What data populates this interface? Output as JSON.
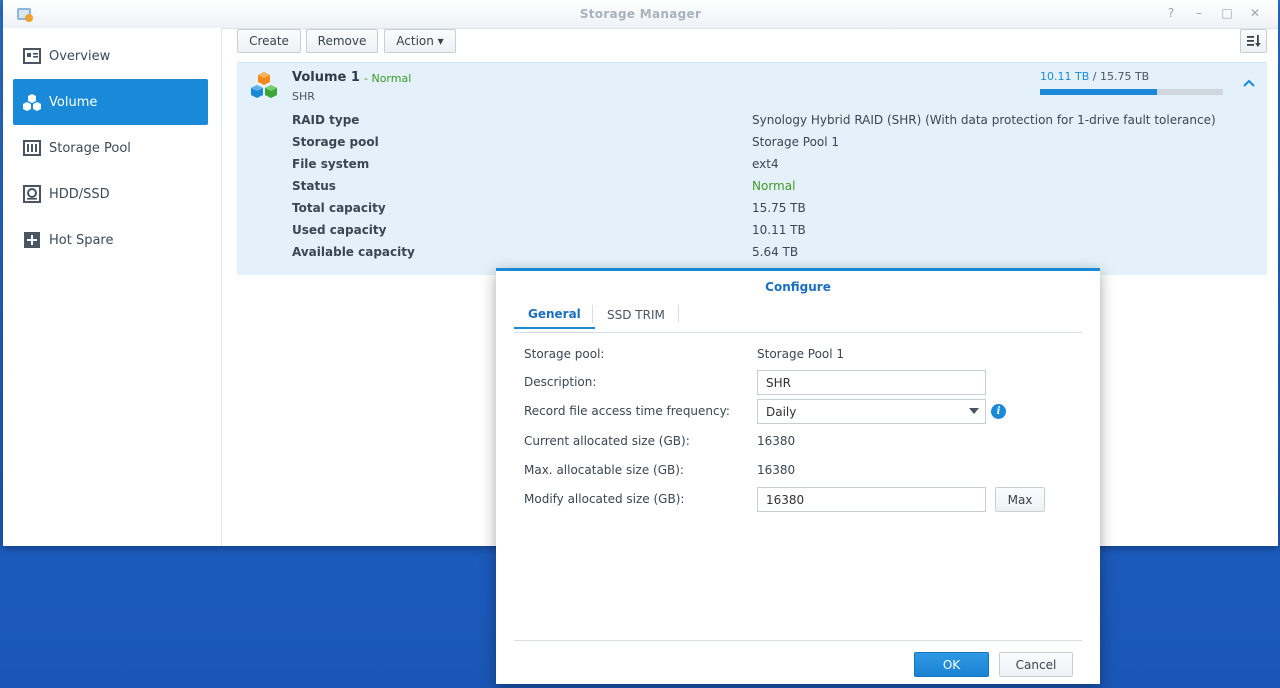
{
  "window": {
    "title": "Storage Manager",
    "help": "?",
    "minimize": "–",
    "maximize": "□",
    "close": "✕"
  },
  "sidebar": {
    "items": [
      {
        "label": "Overview",
        "icon": "overview-icon",
        "active": false
      },
      {
        "label": "Volume",
        "icon": "volume-icon",
        "active": true
      },
      {
        "label": "Storage Pool",
        "icon": "storage-pool-icon",
        "active": false
      },
      {
        "label": "HDD/SSD",
        "icon": "hdd-icon",
        "active": false
      },
      {
        "label": "Hot Spare",
        "icon": "hot-spare-icon",
        "active": false
      }
    ]
  },
  "toolbar": {
    "create": "Create",
    "remove": "Remove",
    "action": "Action ▾",
    "sort_icon": "sort-icon"
  },
  "volume": {
    "name": "Volume 1",
    "status": "- Normal",
    "subtitle": "SHR",
    "used": "10.11 TB",
    "separator": " / ",
    "total": "15.75 TB",
    "usage_fraction": 0.642,
    "details": [
      {
        "key": "RAID type",
        "value": "Synology Hybrid RAID (SHR) (With data protection for 1-drive fault tolerance)"
      },
      {
        "key": "Storage pool",
        "value": "Storage Pool 1"
      },
      {
        "key": "File system",
        "value": "ext4"
      },
      {
        "key": "Status",
        "value": "Normal"
      },
      {
        "key": "Total capacity",
        "value": "15.75 TB"
      },
      {
        "key": "Used capacity",
        "value": "10.11 TB"
      },
      {
        "key": "Available capacity",
        "value": "5.64 TB"
      }
    ]
  },
  "dialog": {
    "title": "Configure",
    "tabs": [
      "General",
      "SSD TRIM"
    ],
    "fields": {
      "storage_pool_label": "Storage pool:",
      "storage_pool_value": "Storage Pool 1",
      "description_label": "Description:",
      "description_value": "SHR",
      "record_label": "Record file access time frequency:",
      "record_value": "Daily",
      "current_label": "Current allocated size (GB):",
      "current_value": "16380",
      "max_label": "Max. allocatable size (GB):",
      "max_value": "16380",
      "modify_label": "Modify allocated size (GB):",
      "modify_value": "16380",
      "max_button": "Max"
    },
    "ok": "OK",
    "cancel": "Cancel"
  },
  "colors": {
    "accent": "#1a8ad8",
    "status_ok": "#3e9a28",
    "desktop": "#1d5fc2"
  }
}
